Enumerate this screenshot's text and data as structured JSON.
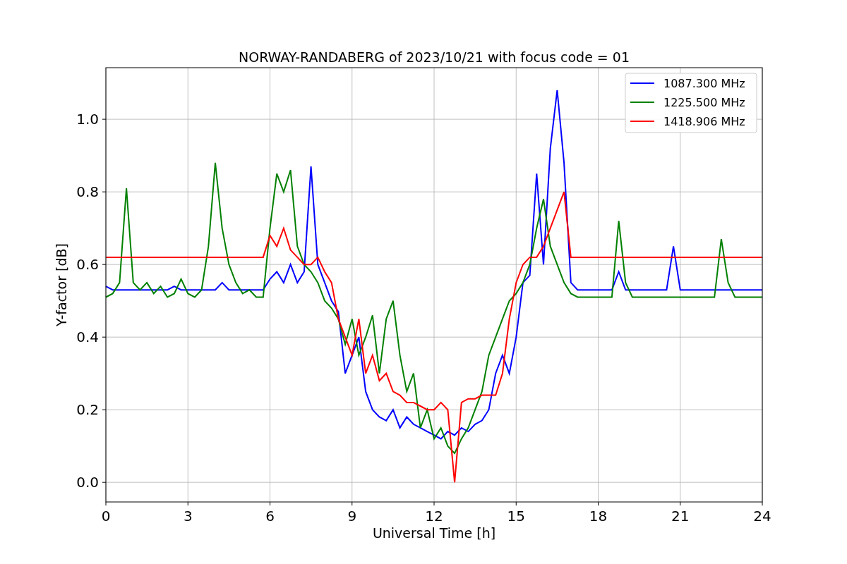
{
  "figure": {
    "chart_data": {
      "type": "line",
      "title": "NORWAY-RANDABERG of 2023/10/21 with focus code = 01",
      "xlabel": "Universal Time [h]",
      "ylabel": "Y-factor [dB]",
      "x": [
        0,
        0.25,
        0.5,
        0.75,
        1,
        1.25,
        1.5,
        1.75,
        2,
        2.25,
        2.5,
        2.75,
        3,
        3.25,
        3.5,
        3.75,
        4,
        4.25,
        4.5,
        4.75,
        5,
        5.25,
        5.5,
        5.75,
        6,
        6.25,
        6.5,
        6.75,
        7,
        7.25,
        7.5,
        7.75,
        8,
        8.25,
        8.5,
        8.75,
        9,
        9.25,
        9.5,
        9.75,
        10,
        10.25,
        10.5,
        10.75,
        11,
        11.25,
        11.5,
        11.75,
        12,
        12.25,
        12.5,
        12.75,
        13,
        13.25,
        13.5,
        13.75,
        14,
        14.25,
        14.5,
        14.75,
        15,
        15.25,
        15.5,
        15.75,
        16,
        16.25,
        16.5,
        16.75,
        17,
        17.25,
        17.5,
        17.75,
        18,
        18.25,
        18.5,
        18.75,
        19,
        19.25,
        19.5,
        19.75,
        20,
        20.25,
        20.5,
        20.75,
        21,
        21.25,
        21.5,
        21.75,
        22,
        22.25,
        22.5,
        22.75,
        23,
        23.25,
        23.5,
        23.75,
        24
      ],
      "series": [
        {
          "name": "1087.300 MHz",
          "color": "#0000ff",
          "values": [
            0.54,
            0.53,
            0.53,
            0.53,
            0.53,
            0.53,
            0.53,
            0.53,
            0.53,
            0.53,
            0.54,
            0.53,
            0.53,
            0.53,
            0.53,
            0.53,
            0.53,
            0.55,
            0.53,
            0.53,
            0.53,
            0.53,
            0.53,
            0.53,
            0.56,
            0.58,
            0.55,
            0.6,
            0.55,
            0.58,
            0.87,
            0.6,
            0.55,
            0.5,
            0.47,
            0.3,
            0.35,
            0.4,
            0.25,
            0.2,
            0.18,
            0.17,
            0.2,
            0.15,
            0.18,
            0.16,
            0.15,
            0.14,
            0.13,
            0.12,
            0.14,
            0.13,
            0.15,
            0.14,
            0.16,
            0.17,
            0.2,
            0.3,
            0.35,
            0.3,
            0.4,
            0.55,
            0.57,
            0.85,
            0.6,
            0.92,
            1.08,
            0.88,
            0.55,
            0.53,
            0.53,
            0.53,
            0.53,
            0.53,
            0.53,
            0.58,
            0.53,
            0.53,
            0.53,
            0.53,
            0.53,
            0.53,
            0.53,
            0.65,
            0.53,
            0.53,
            0.53,
            0.53,
            0.53,
            0.53,
            0.53,
            0.53,
            0.53,
            0.53,
            0.53,
            0.53,
            0.53
          ]
        },
        {
          "name": "1225.500 MHz",
          "color": "#008000",
          "values": [
            0.51,
            0.52,
            0.55,
            0.81,
            0.55,
            0.53,
            0.55,
            0.52,
            0.54,
            0.51,
            0.52,
            0.56,
            0.52,
            0.51,
            0.53,
            0.65,
            0.88,
            0.7,
            0.6,
            0.55,
            0.52,
            0.53,
            0.51,
            0.51,
            0.7,
            0.85,
            0.8,
            0.86,
            0.65,
            0.6,
            0.58,
            0.55,
            0.5,
            0.48,
            0.45,
            0.38,
            0.45,
            0.35,
            0.4,
            0.46,
            0.3,
            0.45,
            0.5,
            0.35,
            0.25,
            0.3,
            0.15,
            0.2,
            0.12,
            0.15,
            0.1,
            0.08,
            0.12,
            0.15,
            0.2,
            0.25,
            0.35,
            0.4,
            0.45,
            0.5,
            0.52,
            0.55,
            0.6,
            0.7,
            0.78,
            0.65,
            0.6,
            0.55,
            0.52,
            0.51,
            0.51,
            0.51,
            0.51,
            0.51,
            0.51,
            0.72,
            0.55,
            0.51,
            0.51,
            0.51,
            0.51,
            0.51,
            0.51,
            0.51,
            0.51,
            0.51,
            0.51,
            0.51,
            0.51,
            0.51,
            0.67,
            0.55,
            0.51,
            0.51,
            0.51,
            0.51,
            0.51
          ]
        },
        {
          "name": "1418.906 MHz",
          "color": "#ff0000",
          "values": [
            0.62,
            0.62,
            0.62,
            0.62,
            0.62,
            0.62,
            0.62,
            0.62,
            0.62,
            0.62,
            0.62,
            0.62,
            0.62,
            0.62,
            0.62,
            0.62,
            0.62,
            0.62,
            0.62,
            0.62,
            0.62,
            0.62,
            0.62,
            0.62,
            0.68,
            0.65,
            0.7,
            0.64,
            0.62,
            0.6,
            0.6,
            0.62,
            0.58,
            0.55,
            0.45,
            0.4,
            0.35,
            0.45,
            0.3,
            0.35,
            0.28,
            0.3,
            0.25,
            0.24,
            0.22,
            0.22,
            0.21,
            0.2,
            0.2,
            0.22,
            0.2,
            0.0,
            0.22,
            0.23,
            0.23,
            0.24,
            0.24,
            0.24,
            0.3,
            0.45,
            0.55,
            0.6,
            0.62,
            0.62,
            0.65,
            0.7,
            0.75,
            0.8,
            0.62,
            0.62,
            0.62,
            0.62,
            0.62,
            0.62,
            0.62,
            0.62,
            0.62,
            0.62,
            0.62,
            0.62,
            0.62,
            0.62,
            0.62,
            0.62,
            0.62,
            0.62,
            0.62,
            0.62,
            0.62,
            0.62,
            0.62,
            0.62,
            0.62,
            0.62,
            0.62,
            0.62,
            0.62
          ]
        }
      ],
      "grid": true,
      "legend": true,
      "xlim": [
        0,
        24
      ],
      "ylim": [
        -0.054,
        1.142
      ],
      "xticks": [
        0,
        3,
        6,
        9,
        12,
        15,
        18,
        21,
        24
      ],
      "yticks": [
        {
          "value": 0,
          "label": "0.0"
        },
        {
          "value": 0.2,
          "label": "0.2"
        },
        {
          "value": 0.4,
          "label": "0.4"
        },
        {
          "value": 0.6,
          "label": "0.6"
        },
        {
          "value": 0.8,
          "label": "0.8"
        },
        {
          "value": 1.0,
          "label": "1.0"
        }
      ]
    }
  }
}
